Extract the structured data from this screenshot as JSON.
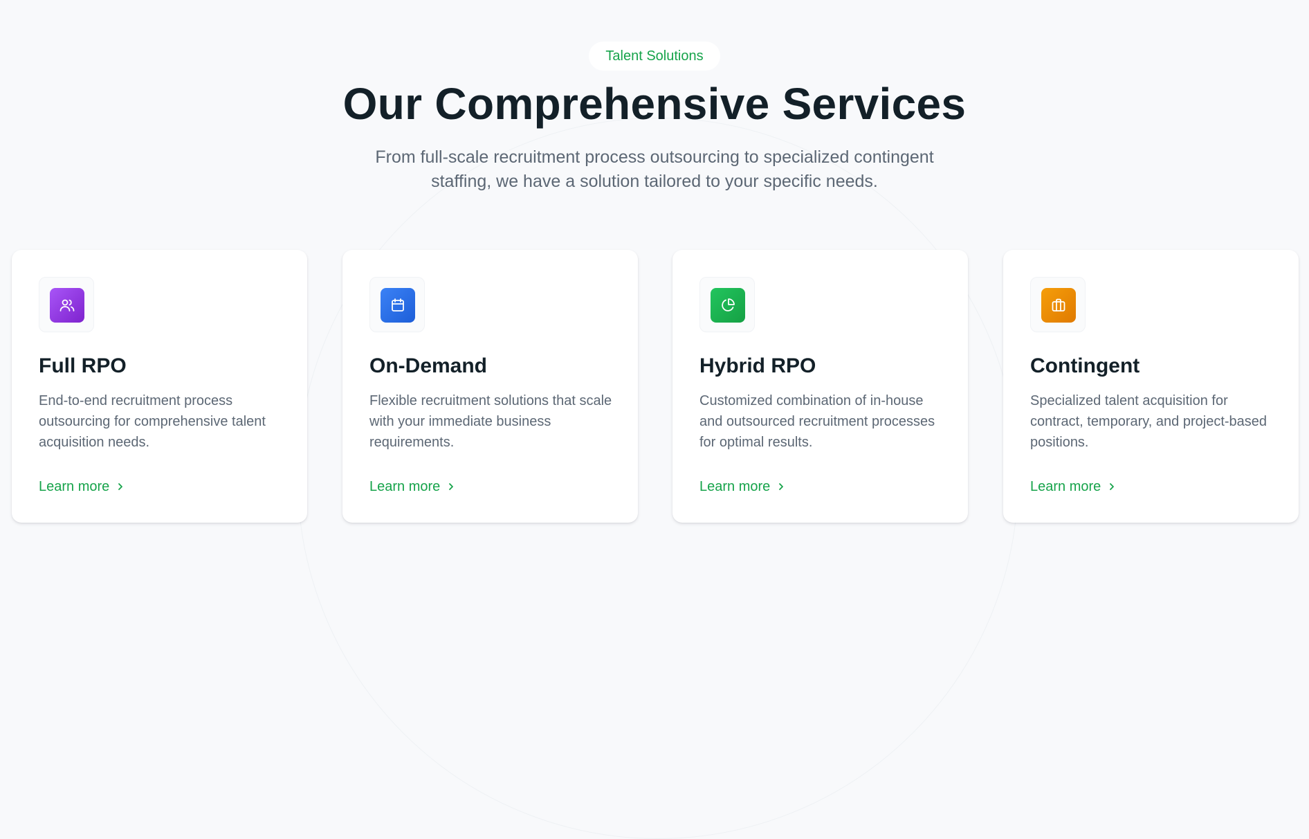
{
  "header": {
    "badge": "Talent Solutions",
    "title": "Our Comprehensive Services",
    "subtitle": "From full-scale recruitment process outsourcing to specialized contingent staffing, we have a solution tailored to your specific needs."
  },
  "services": [
    {
      "title": "Full RPO",
      "description": "End-to-end recruitment process outsourcing for comprehensive talent acquisition needs.",
      "link_label": "Learn more",
      "icon": "users-icon",
      "accent": "#9333ea"
    },
    {
      "title": "On-Demand",
      "description": "Flexible recruitment solutions that scale with your immediate business requirements.",
      "link_label": "Learn more",
      "icon": "calendar-icon",
      "accent": "#2f6fe4"
    },
    {
      "title": "Hybrid RPO",
      "description": "Customized combination of in-house and outsourced recruitment processes for optimal results.",
      "link_label": "Learn more",
      "icon": "pie-chart-icon",
      "accent": "#16a34a"
    },
    {
      "title": "Contingent",
      "description": "Specialized talent acquisition for contract, temporary, and project-based positions.",
      "link_label": "Learn more",
      "icon": "briefcase-icon",
      "accent": "#f08c00"
    }
  ],
  "colors": {
    "brand_green": "#16a34a",
    "heading": "#132028",
    "body_text": "#5c6774",
    "page_background": "#f8f9fb"
  }
}
